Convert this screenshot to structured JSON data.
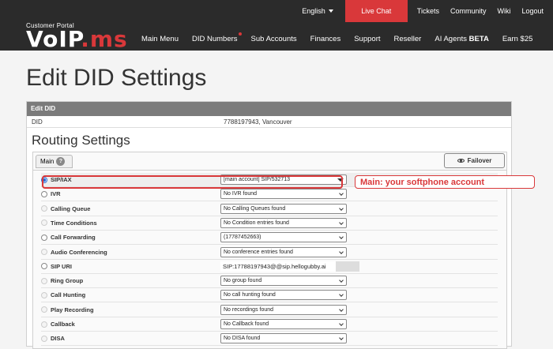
{
  "header": {
    "language": "English",
    "live_chat": "Live Chat",
    "top_links": [
      "Tickets",
      "Community",
      "Wiki",
      "Logout"
    ],
    "logo_sub": "Customer Portal",
    "logo_main_a": "VoIP",
    "logo_main_b": ".ms",
    "nav": [
      {
        "label": "Main Menu"
      },
      {
        "label": "DID Numbers",
        "badge": true
      },
      {
        "label": "Sub Accounts"
      },
      {
        "label": "Finances"
      },
      {
        "label": "Support"
      },
      {
        "label": "Reseller"
      },
      {
        "label": "AI Agents",
        "strong": "BETA"
      },
      {
        "label": "Earn $25"
      }
    ]
  },
  "page": {
    "title": "Edit DID Settings",
    "panel_header": "Edit DID",
    "did_label": "DID",
    "did_value": "7788197943, Vancouver",
    "routing_title": "Routing Settings",
    "tab_main": "Main",
    "failover_label": "Failover"
  },
  "routes": [
    {
      "label": "SIP/IAX",
      "value": "[main account] SIP/532713",
      "state": "selected",
      "type": "select"
    },
    {
      "label": "IVR",
      "value": "No IVR found",
      "state": "normal",
      "type": "select"
    },
    {
      "label": "Calling Queue",
      "value": "No Calling Queues found",
      "state": "disabled",
      "type": "select"
    },
    {
      "label": "Time Conditions",
      "value": "No Condition entries found",
      "state": "disabled",
      "type": "select"
    },
    {
      "label": "Call Forwarding",
      "value": "(17787452663)",
      "state": "normal",
      "type": "select"
    },
    {
      "label": "Audio Conferencing",
      "value": "No conference entries found",
      "state": "disabled",
      "type": "select"
    },
    {
      "label": "SIP URI",
      "value": "SIP:17788197943@",
      "suffix": "@sip.hellogubby.ai",
      "state": "normal",
      "type": "input"
    },
    {
      "label": "Ring Group",
      "value": "No group found",
      "state": "disabled",
      "type": "select"
    },
    {
      "label": "Call Hunting",
      "value": "No call hunting found",
      "state": "disabled",
      "type": "select"
    },
    {
      "label": "Play Recording",
      "value": "No recordings found",
      "state": "disabled",
      "type": "select"
    },
    {
      "label": "Callback",
      "value": "No Callback found",
      "state": "disabled",
      "type": "select"
    },
    {
      "label": "DISA",
      "value": "No DISA found",
      "state": "disabled",
      "type": "select"
    }
  ],
  "annotation": {
    "callout_text": "Main: your softphone account",
    "color": "#d9383a"
  },
  "colors": {
    "brand_red": "#d9383a",
    "topbar": "#2b2b2b",
    "panel_header": "#7b7b7b"
  }
}
